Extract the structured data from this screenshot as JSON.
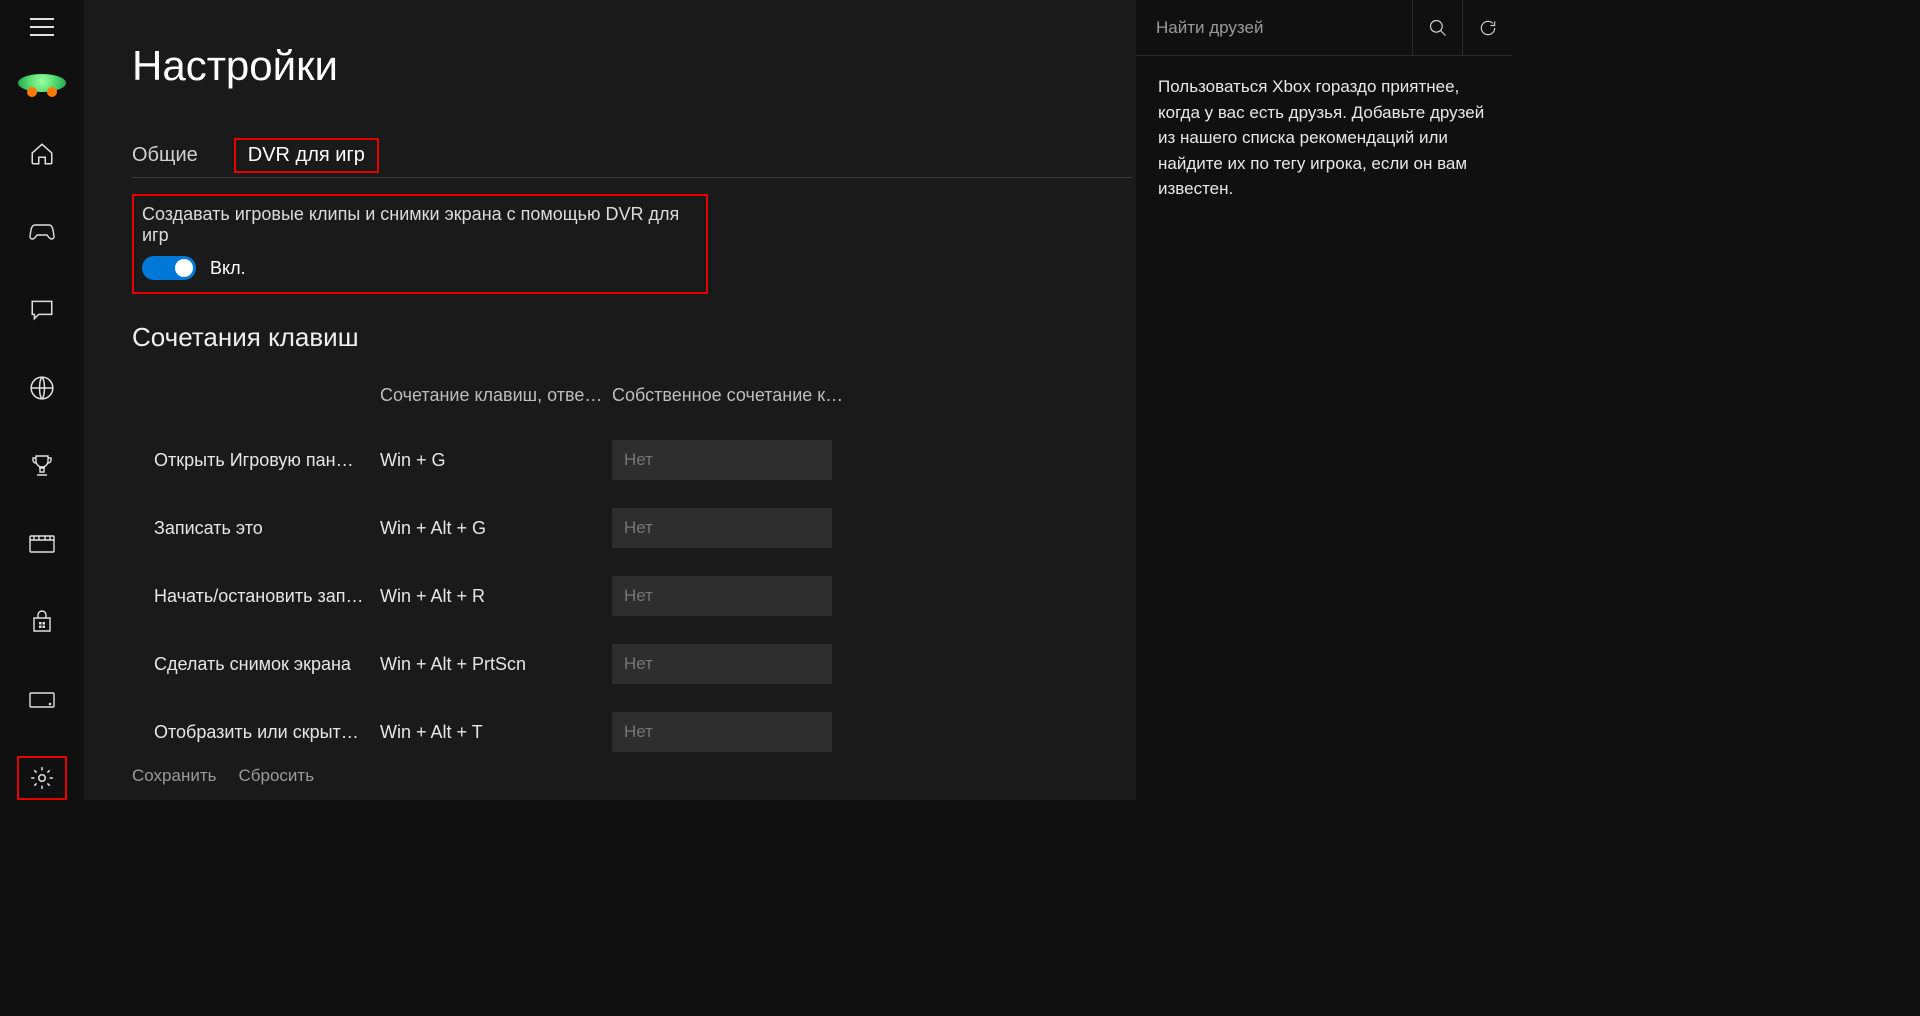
{
  "page_title": "Настройки",
  "tabs": {
    "general": "Общие",
    "dvr": "DVR для игр"
  },
  "dvr": {
    "label": "Создавать игровые клипы и снимки экрана с помощью DVR для игр",
    "state": "Вкл."
  },
  "shortcuts_title": "Сочетания клавиш",
  "shortcut_head": {
    "default": "Сочетание клавиш, отве…",
    "custom": "Собственное сочетание к…"
  },
  "shortcut_placeholder": "Нет",
  "shortcuts": [
    {
      "name": "Открыть Игровую пан…",
      "default": "Win + G"
    },
    {
      "name": "Записать это",
      "default": "Win + Alt + G"
    },
    {
      "name": "Начать/остановить зап…",
      "default": "Win + Alt + R"
    },
    {
      "name": "Сделать снимок экрана",
      "default": "Win + Alt + PrtScn"
    },
    {
      "name": "Отобразить или скрыт…",
      "default": "Win + Alt + T"
    }
  ],
  "actions": {
    "save": "Сохранить",
    "reset": "Сбросить"
  },
  "friends": {
    "search_placeholder": "Найти друзей",
    "empty_text": "Пользоваться Xbox гораздо приятнее, когда у вас есть друзья. Добавьте друзей из нашего списка рекомендаций или найдите их по тегу игрока, если он вам известен."
  }
}
